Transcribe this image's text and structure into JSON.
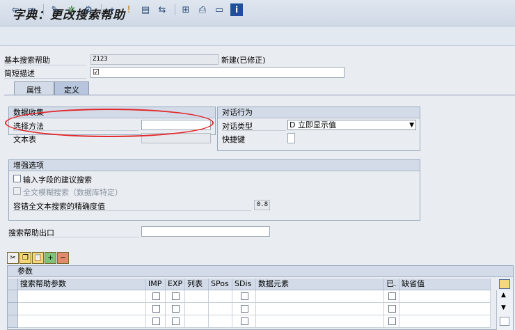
{
  "window": {
    "title": "字典：更改搜索帮助"
  },
  "toolbar": {
    "buttons": [
      "back-icon",
      "forward-icon",
      "edit-icon",
      "check-icon",
      "activate-icon",
      "where-used-icon",
      "info-icon",
      "display-icon",
      "navigate-icon",
      "hierarchy-icon",
      "print-icon",
      "layout-icon",
      "help-info-icon"
    ]
  },
  "header": {
    "search_help_label": "基本搜索帮助",
    "search_help_value": "Z123",
    "status_text": "新建(已修正)",
    "short_desc_label": "简短描述",
    "short_desc_value": "☑"
  },
  "tabs": [
    {
      "label": "属性",
      "active": false
    },
    {
      "label": "定义",
      "active": true
    }
  ],
  "data_collection": {
    "title": "数据收集",
    "selection_method_label": "选择方法",
    "selection_method_value": "",
    "text_table_label": "文本表",
    "text_table_value": ""
  },
  "dialog_behavior": {
    "title": "对话行为",
    "dialog_type_label": "对话类型",
    "dialog_type_value": "D 立即显示值",
    "hotkey_label": "快捷键",
    "hotkey_value": ""
  },
  "enhanced_options": {
    "title": "增强选项",
    "input_field_suggest_label": "输入字段的建议搜索",
    "input_field_suggest_checked": false,
    "fulltext_fuzzy_label": "全文模糊搜索（数据库特定）",
    "fulltext_fuzzy_checked": false,
    "fulltext_fuzzy_disabled": true,
    "accuracy_label": "容错全文本搜索的精确度值",
    "accuracy_value": "0.8"
  },
  "exit": {
    "label": "搜索帮助出口",
    "value": ""
  },
  "params_table": {
    "title": "参数",
    "columns": [
      "搜索帮助参数",
      "IMP",
      "EXP",
      "列表",
      "SPos",
      "SDis",
      "数据元素",
      "已.",
      "缺省值"
    ],
    "row_count": 3
  },
  "accent_colors": {
    "highlight_ellipse": "#e3262a",
    "panel_header": "#d2dbe7"
  }
}
